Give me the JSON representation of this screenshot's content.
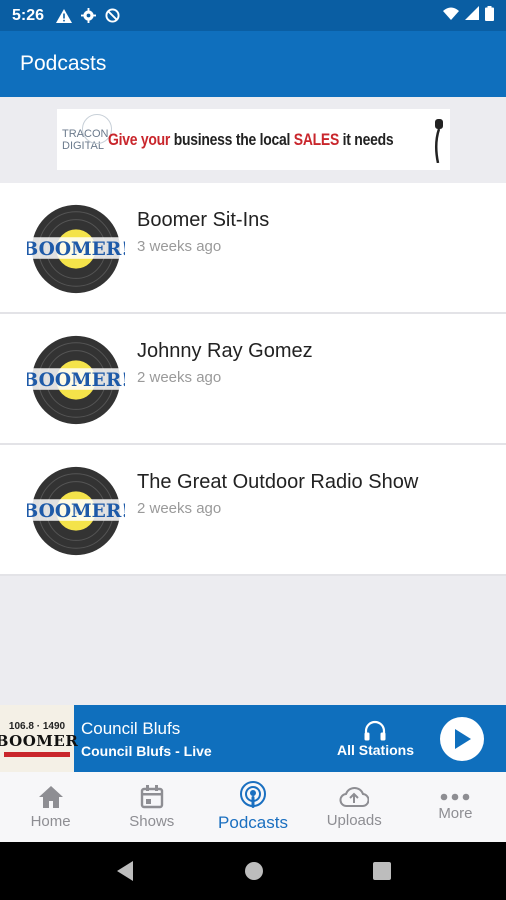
{
  "status": {
    "time": "5:26"
  },
  "header": {
    "title": "Podcasts"
  },
  "banner": {
    "brand": "TRACON DIGITAL",
    "tag_part1": "Give ",
    "tag_part2": "your",
    "tag_part3": " business the local ",
    "tag_part4": "SALES",
    "tag_part5": " it needs"
  },
  "podcasts": [
    {
      "title": "Boomer Sit-Ins",
      "age": "3 weeks ago"
    },
    {
      "title": "Johnny Ray Gomez",
      "age": "2 weeks ago"
    },
    {
      "title": "The Great Outdoor Radio Show",
      "age": "2 weeks ago"
    }
  ],
  "player": {
    "art_freq": "106.8 · 1490",
    "art_word": "BOOMER",
    "station": "Council Blufs",
    "live": "Council Blufs - Live",
    "all_stations": "All Stations"
  },
  "nav": {
    "home": "Home",
    "shows": "Shows",
    "podcasts": "Podcasts",
    "uploads": "Uploads",
    "more": "More"
  },
  "colors": {
    "primary": "#0f6fbd",
    "status": "#0a5ea3",
    "active_tab": "#1a6fc0",
    "accent_red": "#c9262c"
  }
}
